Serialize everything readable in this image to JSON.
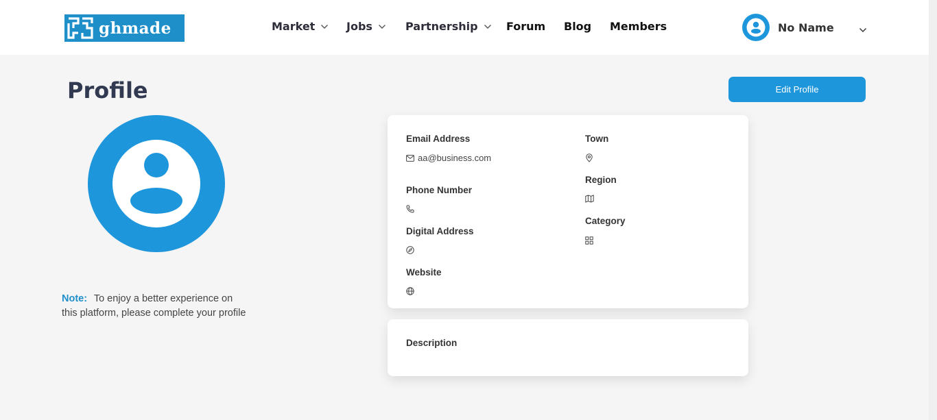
{
  "header": {
    "logo_text": "ghmade",
    "nav": [
      {
        "label": "Market",
        "has_dropdown": true
      },
      {
        "label": "Jobs",
        "has_dropdown": true
      },
      {
        "label": "Partnership",
        "has_dropdown": true
      },
      {
        "label": "Forum",
        "has_dropdown": false
      },
      {
        "label": "Blog",
        "has_dropdown": false
      },
      {
        "label": "Members",
        "has_dropdown": false
      }
    ],
    "user_name": "No Name"
  },
  "page": {
    "title": "Profile",
    "edit_button": "Edit Profile"
  },
  "note": {
    "label": "Note:",
    "text": "To enjoy a better experience on this platform, please complete your profile"
  },
  "details": {
    "email_label": "Email Address",
    "email_value": "aa@business.com",
    "phone_label": "Phone Number",
    "phone_value": "",
    "digital_address_label": "Digital Address",
    "digital_address_value": "",
    "website_label": "Website",
    "website_value": "",
    "town_label": "Town",
    "town_value": "",
    "region_label": "Region",
    "region_value": "",
    "category_label": "Category",
    "category_value": ""
  },
  "description": {
    "label": "Description",
    "value": ""
  },
  "colors": {
    "accent": "#1e96dc",
    "logo_bg": "#1e8fc9",
    "title": "#323a52",
    "background": "#f5f5f5"
  },
  "icons": [
    "logo-maze-icon",
    "chevron-down-icon",
    "user-avatar-icon",
    "mail-icon",
    "phone-icon",
    "compass-icon",
    "globe-icon",
    "map-pin-icon",
    "map-icon",
    "grid-icon"
  ]
}
